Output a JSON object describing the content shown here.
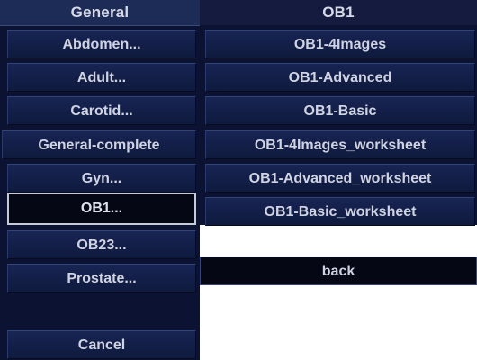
{
  "left_panel": {
    "header": "General",
    "items": [
      {
        "label": "Abdomen..."
      },
      {
        "label": "Adult..."
      },
      {
        "label": "Carotid..."
      },
      {
        "label": "General-complete"
      },
      {
        "label": "Gyn..."
      },
      {
        "label": "OB1...",
        "selected": true
      },
      {
        "label": "OB23..."
      },
      {
        "label": "Prostate..."
      },
      {
        "label": "Cancel"
      }
    ]
  },
  "right_panel": {
    "header": "OB1",
    "items": [
      {
        "label": "OB1-4Images"
      },
      {
        "label": "OB1-Advanced"
      },
      {
        "label": "OB1-Basic"
      },
      {
        "label": "OB1-4Images_worksheet"
      },
      {
        "label": "OB1-Advanced_worksheet"
      },
      {
        "label": "OB1-Basic_worksheet"
      }
    ],
    "back_label": "back"
  },
  "colors": {
    "panel_background": "#0c1332",
    "button_background": "#182453",
    "selected_border": "#c7cbd8",
    "text": "#cfd3e2"
  }
}
